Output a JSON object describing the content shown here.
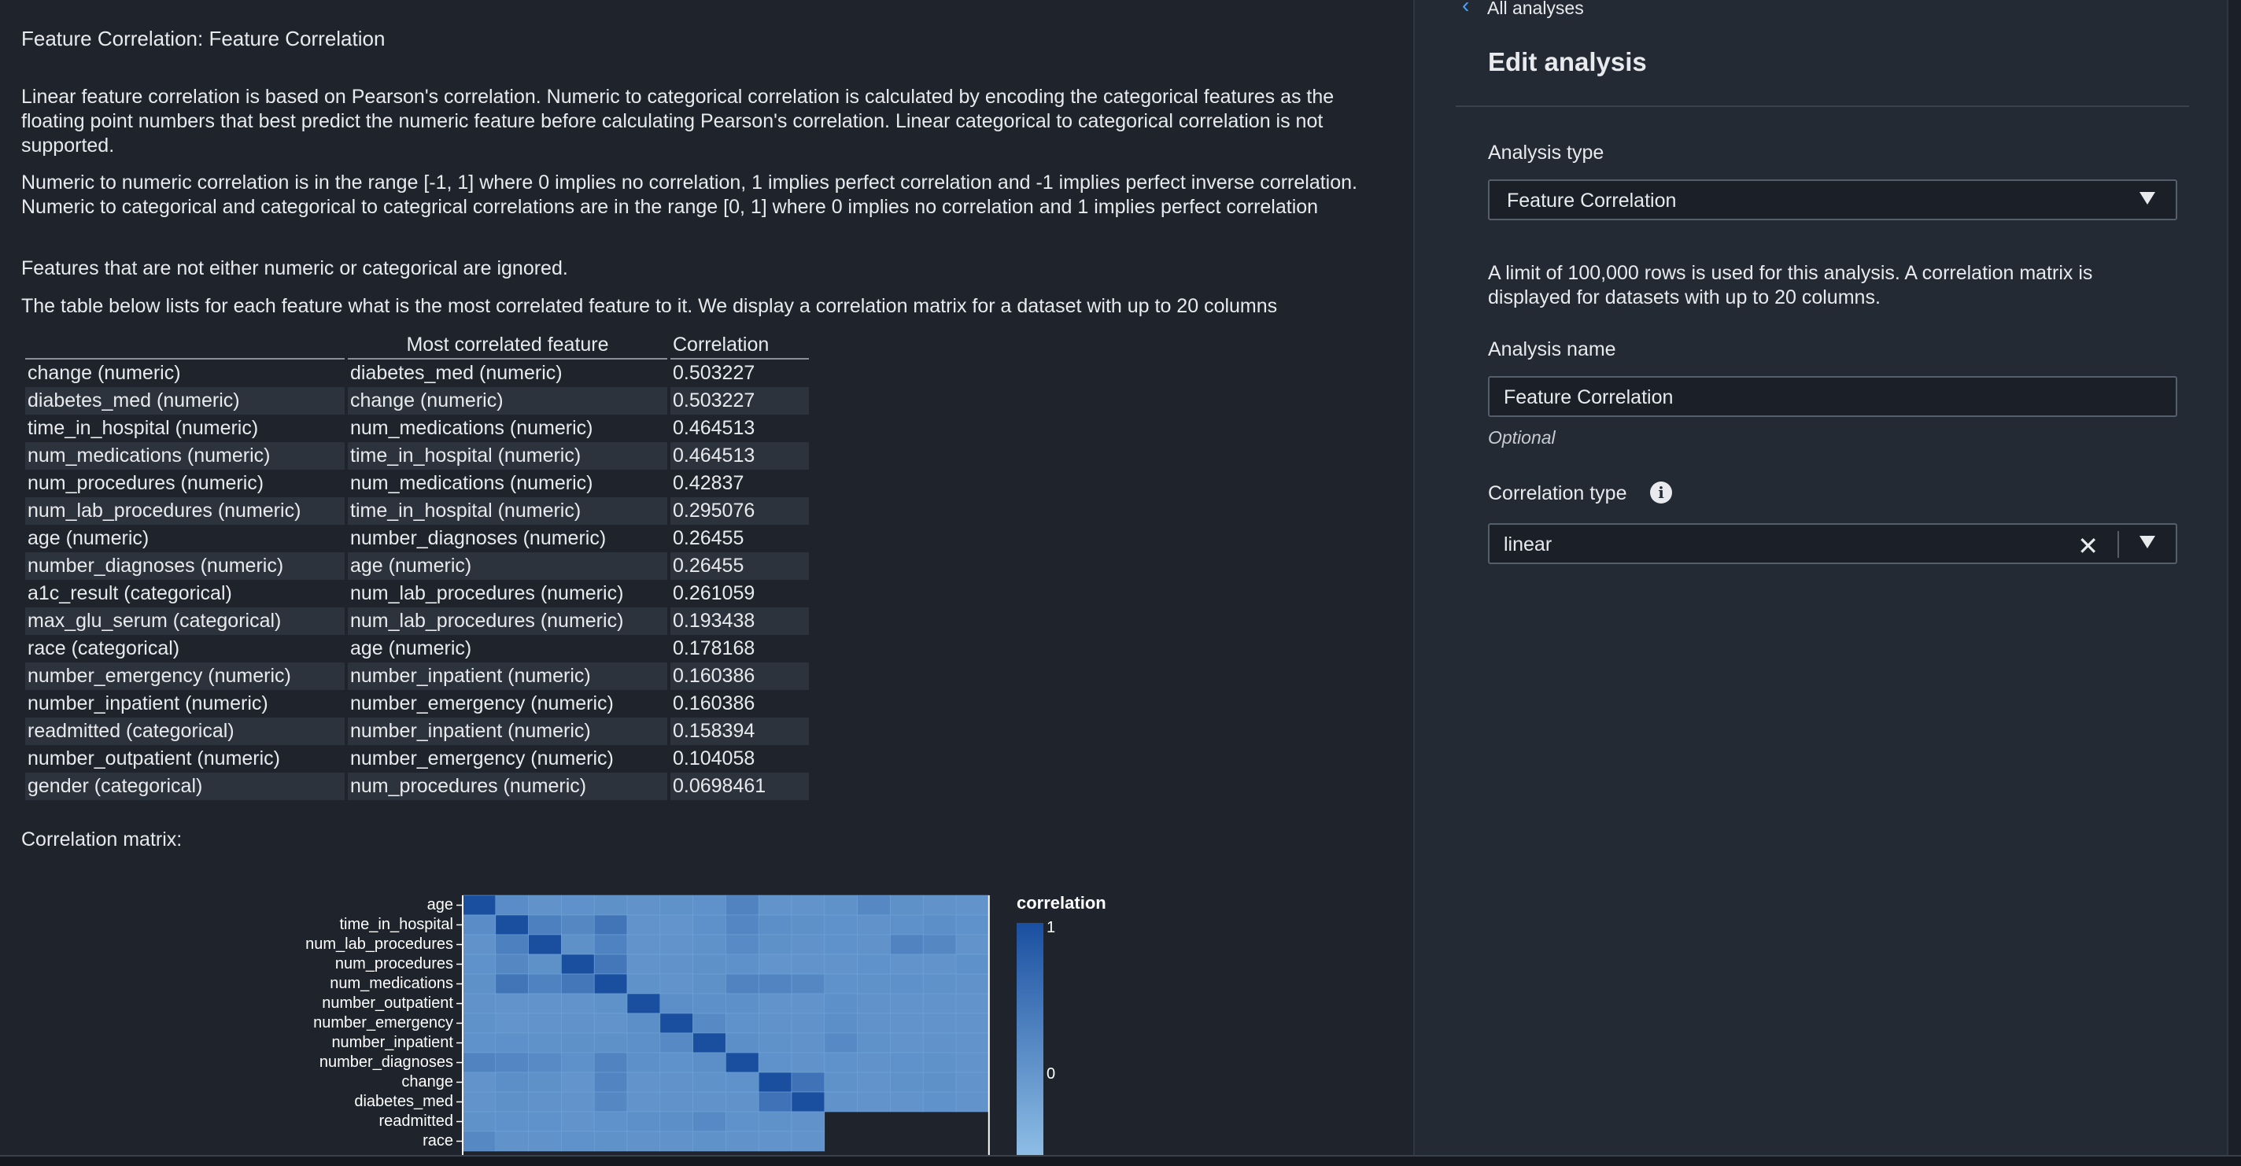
{
  "report": {
    "title": "Feature Correlation: Feature Correlation",
    "paragraphs": [
      "Linear feature correlation is based on Pearson's correlation. Numeric to categorical correlation is calculated by encoding the categorical features as the floating point numbers that best predict the numeric feature before calculating Pearson's correlation. Linear categorical to categorical correlation is not supported.",
      "Numeric to numeric correlation is in the range [-1, 1] where 0 implies no correlation, 1 implies perfect correlation and -1 implies perfect inverse correlation. Numeric to categorical and categorical to categrical correlations are in the range [0, 1] where 0 implies no correlation and 1 implies perfect correlation",
      "Features that are not either numeric or categorical are ignored.",
      "The table below lists for each feature what is the most correlated feature to it. We display a correlation matrix for a dataset with up to 20 columns"
    ],
    "table": {
      "headers": [
        "",
        "Most correlated feature",
        "Correlation"
      ],
      "rows": [
        [
          "change (numeric)",
          "diabetes_med (numeric)",
          "0.503227"
        ],
        [
          "diabetes_med (numeric)",
          "change (numeric)",
          "0.503227"
        ],
        [
          "time_in_hospital (numeric)",
          "num_medications (numeric)",
          "0.464513"
        ],
        [
          "num_medications (numeric)",
          "time_in_hospital (numeric)",
          "0.464513"
        ],
        [
          "num_procedures (numeric)",
          "num_medications (numeric)",
          "0.42837"
        ],
        [
          "num_lab_procedures (numeric)",
          "time_in_hospital (numeric)",
          "0.295076"
        ],
        [
          "age (numeric)",
          "number_diagnoses (numeric)",
          "0.26455"
        ],
        [
          "number_diagnoses (numeric)",
          "age (numeric)",
          "0.26455"
        ],
        [
          "a1c_result (categorical)",
          "num_lab_procedures (numeric)",
          "0.261059"
        ],
        [
          "max_glu_serum (categorical)",
          "num_lab_procedures (numeric)",
          "0.193438"
        ],
        [
          "race (categorical)",
          "age (numeric)",
          "0.178168"
        ],
        [
          "number_emergency (numeric)",
          "number_inpatient (numeric)",
          "0.160386"
        ],
        [
          "number_inpatient (numeric)",
          "number_emergency (numeric)",
          "0.160386"
        ],
        [
          "readmitted (categorical)",
          "number_inpatient (numeric)",
          "0.158394"
        ],
        [
          "number_outpatient (numeric)",
          "number_emergency (numeric)",
          "0.104058"
        ],
        [
          "gender (categorical)",
          "num_procedures (numeric)",
          "0.0698461"
        ]
      ]
    },
    "matrix_label": "Correlation matrix:"
  },
  "chart_data": {
    "type": "heatmap",
    "row_labels": [
      "age",
      "time_in_hospital",
      "num_lab_procedures",
      "num_procedures",
      "num_medications",
      "number_outpatient",
      "number_emergency",
      "number_inpatient",
      "number_diagnoses",
      "change",
      "diabetes_med",
      "readmitted",
      "race"
    ],
    "col_count": 16,
    "visible_full_rows": 11,
    "visible_partial_cols": 11,
    "legend_title": "correlation",
    "legend_ticks": [
      "1",
      "0"
    ],
    "color_high": "#1a4fa0",
    "color_low": "#8fbfe6",
    "values": [
      [
        1.0,
        0.12,
        0.03,
        0.05,
        0.06,
        0.03,
        0.04,
        0.05,
        0.26,
        0.02,
        0.02,
        0.04,
        0.18,
        0.06,
        0.03,
        0.02
      ],
      [
        0.12,
        1.0,
        0.3,
        0.19,
        0.46,
        0.02,
        0.0,
        0.07,
        0.22,
        0.1,
        0.06,
        0.05,
        0.03,
        0.07,
        0.1,
        0.05
      ],
      [
        0.03,
        0.3,
        1.0,
        0.06,
        0.27,
        0.01,
        0.02,
        0.04,
        0.15,
        0.06,
        0.03,
        0.05,
        0.03,
        0.26,
        0.19,
        0.02
      ],
      [
        0.05,
        0.19,
        0.06,
        1.0,
        0.43,
        0.02,
        0.03,
        0.06,
        0.07,
        0.0,
        0.01,
        0.02,
        0.05,
        0.02,
        0.01,
        0.07
      ],
      [
        0.06,
        0.46,
        0.27,
        0.43,
        1.0,
        0.04,
        0.01,
        0.06,
        0.26,
        0.24,
        0.19,
        0.05,
        0.04,
        0.07,
        0.04,
        0.03
      ],
      [
        0.03,
        0.02,
        0.01,
        0.02,
        0.04,
        1.0,
        0.1,
        0.09,
        0.09,
        0.02,
        0.02,
        0.08,
        0.03,
        0.01,
        0.02,
        0.01
      ],
      [
        0.04,
        0.0,
        0.02,
        0.03,
        0.01,
        0.1,
        1.0,
        0.16,
        0.05,
        0.03,
        0.03,
        0.1,
        0.03,
        0.02,
        0.02,
        0.01
      ],
      [
        0.05,
        0.07,
        0.04,
        0.06,
        0.06,
        0.09,
        0.16,
        1.0,
        0.1,
        0.04,
        0.03,
        0.16,
        0.04,
        0.02,
        0.03,
        0.02
      ],
      [
        0.26,
        0.22,
        0.15,
        0.07,
        0.26,
        0.09,
        0.05,
        0.1,
        1.0,
        0.05,
        0.03,
        0.05,
        0.03,
        0.05,
        0.04,
        0.02
      ],
      [
        0.02,
        0.1,
        0.06,
        0.0,
        0.24,
        0.02,
        0.03,
        0.04,
        0.05,
        1.0,
        0.5,
        0.04,
        0.02,
        0.04,
        0.06,
        0.01
      ],
      [
        0.02,
        0.06,
        0.03,
        0.01,
        0.19,
        0.02,
        0.03,
        0.03,
        0.03,
        0.5,
        1.0,
        0.03,
        0.02,
        0.02,
        0.05,
        0.01
      ],
      [
        0.04,
        0.05,
        0.05,
        0.02,
        0.05,
        0.08,
        0.1,
        0.16,
        0.05,
        0.04,
        0.03
      ],
      [
        0.18,
        0.03,
        0.03,
        0.05,
        0.04,
        0.03,
        0.03,
        0.04,
        0.03,
        0.02,
        0.02
      ]
    ]
  },
  "panel": {
    "back_label": "All analyses",
    "heading": "Edit analysis",
    "analysis_type_label": "Analysis type",
    "analysis_type_value": "Feature Correlation",
    "help_text": "A limit of 100,000 rows is used for this analysis. A correlation matrix is displayed for datasets with up to 20 columns.",
    "analysis_name_label": "Analysis name",
    "analysis_name_value": "Feature Correlation",
    "optional_label": "Optional",
    "correlation_type_label": "Correlation type",
    "correlation_type_value": "linear"
  },
  "colors": {
    "accent": "#44a4ff",
    "background": "#1f242c"
  }
}
